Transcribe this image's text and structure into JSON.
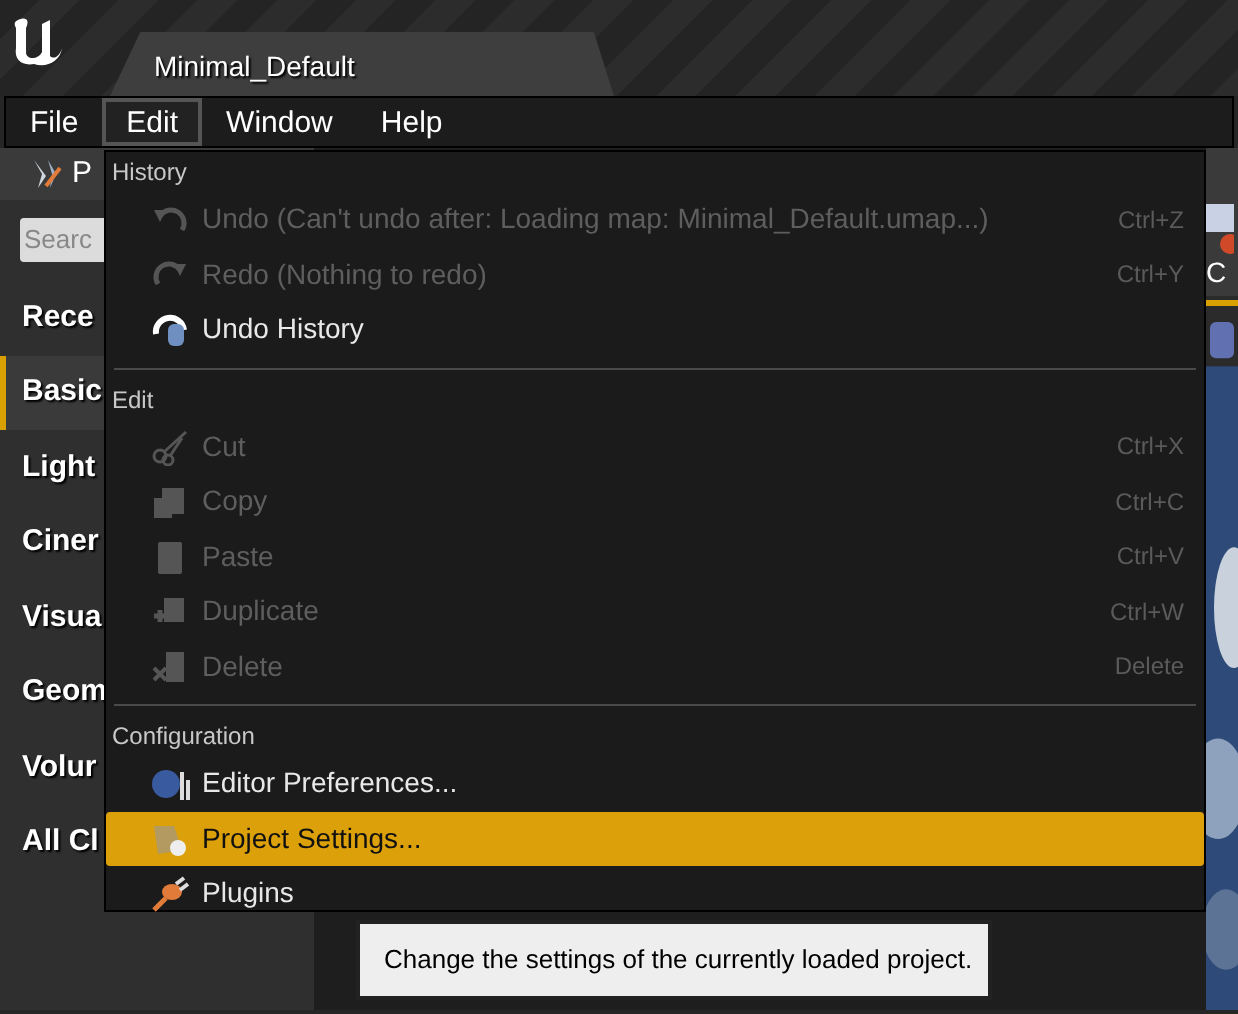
{
  "window": {
    "tab_title": "Minimal_Default"
  },
  "menu_bar": [
    {
      "label": "File",
      "selected": false
    },
    {
      "label": "Edit",
      "selected": true
    },
    {
      "label": "Window",
      "selected": false
    },
    {
      "label": "Help",
      "selected": false
    }
  ],
  "left_panel": {
    "header": "P",
    "search": {
      "placeholder": "Searc"
    },
    "items": [
      {
        "label": "Rece",
        "selected": false
      },
      {
        "label": "Basic",
        "selected": true
      },
      {
        "label": "Light",
        "selected": false
      },
      {
        "label": "Ciner",
        "selected": false
      },
      {
        "label": "Visua",
        "selected": false
      },
      {
        "label": "Geom",
        "selected": false
      },
      {
        "label": "Volur",
        "selected": false
      },
      {
        "label": "All Cl",
        "selected": false
      }
    ]
  },
  "viewport": {
    "button_label": "C"
  },
  "edit_menu": [
    {
      "heading": "History",
      "items": [
        {
          "label": "Undo (Can't undo after: Loading map: Minimal_Default.umap...)",
          "shortcut": "Ctrl+Z",
          "disabled": true,
          "selected": false
        },
        {
          "label": "Redo (Nothing to redo)",
          "shortcut": "Ctrl+Y",
          "disabled": true,
          "selected": false
        },
        {
          "label": "Undo History",
          "disabled": false,
          "selected": false
        }
      ]
    },
    {
      "heading": "Edit",
      "items": [
        {
          "label": "Cut",
          "shortcut": "Ctrl+X",
          "disabled": true,
          "selected": false
        },
        {
          "label": "Copy",
          "shortcut": "Ctrl+C",
          "disabled": true,
          "selected": false
        },
        {
          "label": "Paste",
          "shortcut": "Ctrl+V",
          "disabled": true,
          "selected": false
        },
        {
          "label": "Duplicate",
          "shortcut": "Ctrl+W",
          "disabled": true,
          "selected": false
        },
        {
          "label": "Delete",
          "shortcut": "Delete",
          "disabled": true,
          "selected": false
        }
      ]
    },
    {
      "heading": "Configuration",
      "items": [
        {
          "label": "Editor Preferences...",
          "disabled": false,
          "selected": false
        },
        {
          "label": "Project Settings...",
          "disabled": false,
          "selected": true
        },
        {
          "label": "Plugins",
          "disabled": false,
          "selected": false
        }
      ]
    }
  ],
  "tooltip": "Change the settings of the currently loaded project."
}
